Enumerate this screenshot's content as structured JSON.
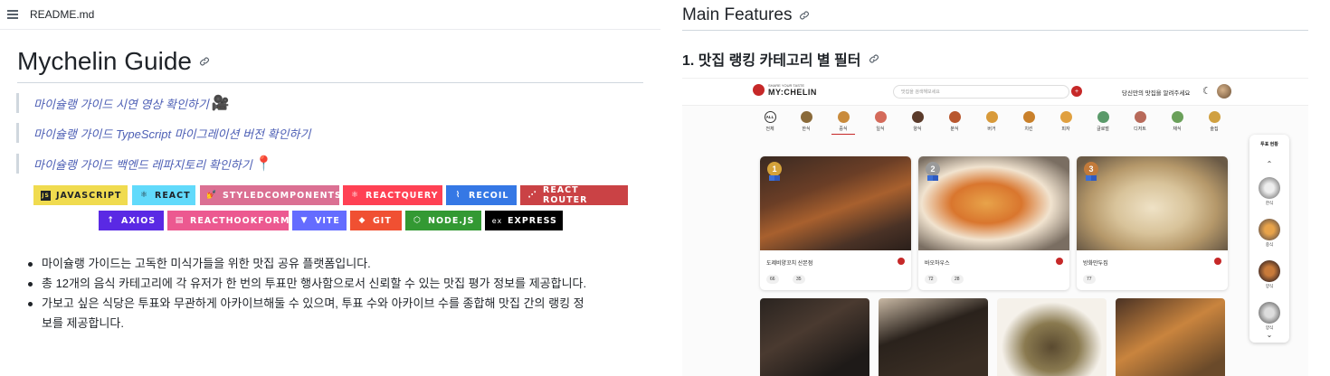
{
  "file_header": {
    "filename": "README.md",
    "icon": "list-icon"
  },
  "readme": {
    "title": "Mychelin Guide",
    "quotes": [
      {
        "text": "마이슐랭 가이드 시연 영상 확인하기",
        "emoji": "🎥"
      },
      {
        "text": "마이슐랭 가이드 TypeScript 마이그레이션 버전 확인하기",
        "emoji": ""
      },
      {
        "text": "마이슐랭 가이드 백엔드 레파지토리 확인하기",
        "emoji": "📍"
      }
    ],
    "badges_row1": [
      {
        "label": "JAVASCRIPT",
        "color": "#f0db4f",
        "text_color": "#1f2328",
        "icon": "JS"
      },
      {
        "label": "REACT",
        "color": "#61dafb",
        "text_color": "#1f2328",
        "icon": "⚛"
      },
      {
        "label": "STYLEDCOMPONENTS",
        "color": "#db7093",
        "text_color": "#ffffff",
        "icon": "💅"
      },
      {
        "label": "REACTQUERY",
        "color": "#ff4154",
        "text_color": "#ffffff",
        "icon": "⚛"
      },
      {
        "label": "RECOIL",
        "color": "#3578e5",
        "text_color": "#ffffff",
        "icon": "⌇"
      },
      {
        "label": "REACT ROUTER",
        "color": "#ca4245",
        "text_color": "#ffffff",
        "icon": "⋰"
      }
    ],
    "badges_row2": [
      {
        "label": "AXIOS",
        "color": "#5a29e4",
        "text_color": "#ffffff",
        "icon": "↑"
      },
      {
        "label": "REACTHOOKFORM",
        "color": "#ec5990",
        "text_color": "#ffffff",
        "icon": "▤"
      },
      {
        "label": "VITE",
        "color": "#646cff",
        "text_color": "#ffffff",
        "icon": "▼"
      },
      {
        "label": "GIT",
        "color": "#f05032",
        "text_color": "#ffffff",
        "icon": "◆"
      },
      {
        "label": "NODE.JS",
        "color": "#339933",
        "text_color": "#ffffff",
        "icon": "⬡"
      },
      {
        "label": "EXPRESS",
        "color": "#000000",
        "text_color": "#ffffff",
        "icon": "ex"
      }
    ],
    "bullets": [
      "마이슐랭 가이드는 고독한 미식가들을 위한 맛집 공유 플랫폼입니다.",
      "총 12개의 음식 카테고리에 각 유저가 한 번의 투표만 행사함으로서 신뢰할 수 있는 맛집 평가 정보를 제공합니다.",
      "가보고 싶은 식당은 투표와 무관하게 아카이브해둘 수 있으며, 투표 수와 아카이브 수를 종합해 맛집 간의 랭킹 정",
      "보를 제공합니다."
    ]
  },
  "features": {
    "heading": "Main Features",
    "subheading": "1. 맛집 랭킹 카테고리 별 필터"
  },
  "app_screenshot": {
    "logo_sub": "SHARE YOUR TASTE",
    "logo_main": "MY:CHELIN",
    "search_placeholder": "맛집을 검색해보세요",
    "tagline": "당신만의 맛집을 알려주세요",
    "categories": [
      {
        "label": "전체",
        "icon": "ALL"
      },
      {
        "label": "한식",
        "color": "#8a6a3a"
      },
      {
        "label": "중식",
        "color": "#c98b3c"
      },
      {
        "label": "일식",
        "color": "#d46a5a"
      },
      {
        "label": "양식",
        "color": "#5a3a2a"
      },
      {
        "label": "분식",
        "color": "#b8572e"
      },
      {
        "label": "버거",
        "color": "#d89a3a"
      },
      {
        "label": "치킨",
        "color": "#c9802a"
      },
      {
        "label": "피자",
        "color": "#e0a040"
      },
      {
        "label": "글로벌",
        "color": "#5a9a6a"
      },
      {
        "label": "디저트",
        "color": "#b86a5a"
      },
      {
        "label": "채식",
        "color": "#6aa05a"
      },
      {
        "label": "술집",
        "color": "#d0a040"
      }
    ],
    "active_category": "중식",
    "top_cards": [
      {
        "rank": "1",
        "name": "도제비양꼬치 산본점",
        "votes": "66",
        "archives": "35",
        "medal_color": "#d4a23a"
      },
      {
        "rank": "2",
        "name": "바오하우스",
        "votes": "72",
        "archives": "28",
        "medal_color": "#9a9a9a"
      },
      {
        "rank": "3",
        "name": "방화만두집",
        "votes": "77",
        "archives": "",
        "medal_color": "#c27a3a"
      }
    ],
    "side_panel": {
      "title": "투표 현황",
      "items": [
        "한식",
        "중식",
        "양식",
        "양식"
      ]
    }
  }
}
